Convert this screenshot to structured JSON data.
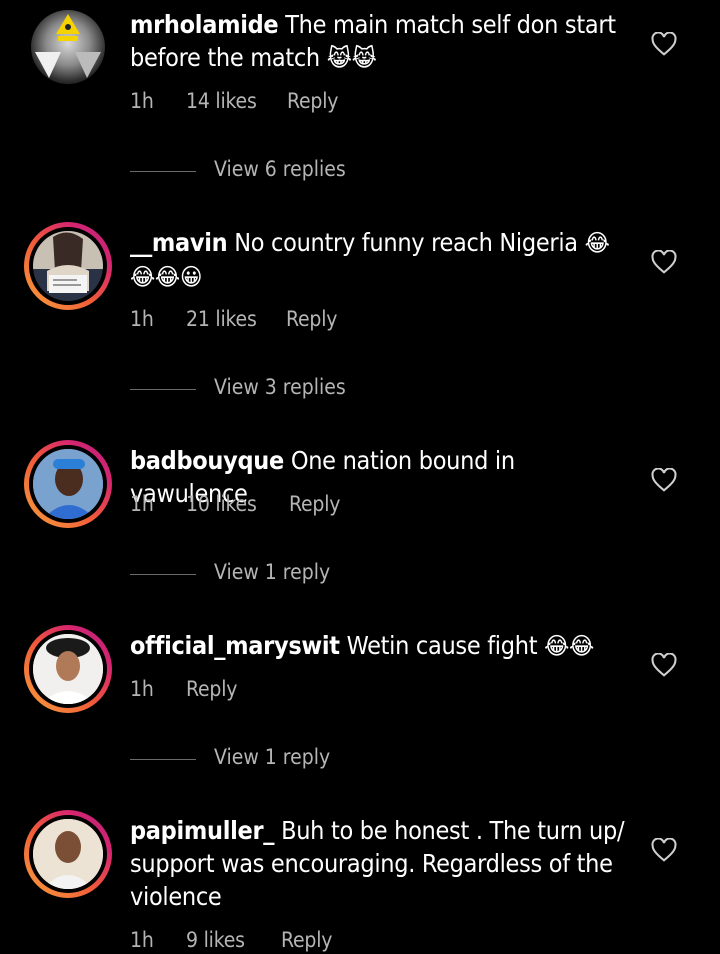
{
  "comments": [
    {
      "username": "mrholamide",
      "text": "The main match self don start before the match",
      "emoji": "😹😹",
      "time": "1h",
      "likes": "14 likes",
      "reply_label": "Reply",
      "view_replies": "View 6 replies",
      "avatar_ring": false
    },
    {
      "username": "__mavin",
      "text": "No country funny reach Nigeria",
      "emoji": "😂😂😂😀",
      "time": "1h",
      "likes": "21 likes",
      "reply_label": "Reply",
      "view_replies": "View 3 replies",
      "avatar_ring": true
    },
    {
      "username": "badbouyque",
      "text": "One nation bound in vawulence",
      "emoji": "",
      "time": "1h",
      "likes": "10 likes",
      "reply_label": "Reply",
      "view_replies": "View 1 reply",
      "avatar_ring": true
    },
    {
      "username": "official_maryswit",
      "text": "Wetin cause fight",
      "emoji": "😂😂",
      "time": "1h",
      "likes": "",
      "reply_label": "Reply",
      "view_replies": "View 1 reply",
      "avatar_ring": true
    },
    {
      "username": "papimuller_",
      "text": "Buh to be honest . The turn up/ support was encouraging. Regardless of the violence",
      "emoji": "",
      "time": "1h",
      "likes": "9 likes",
      "reply_label": "Reply",
      "view_replies": "",
      "avatar_ring": true
    }
  ],
  "icons": {
    "like": "heart-outline-icon"
  },
  "colors": {
    "background": "#000000",
    "meta_text": "#b5b5b5",
    "ring_start": "#f9a23c",
    "ring_end": "#b3207e"
  }
}
